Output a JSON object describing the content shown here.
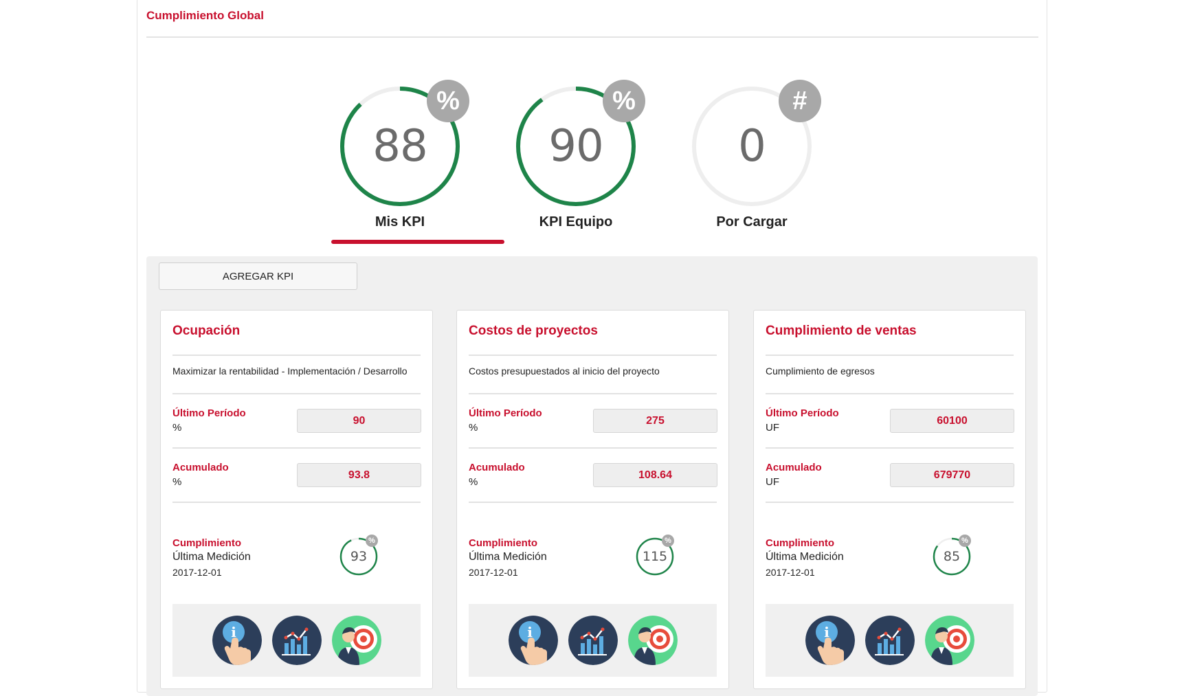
{
  "panel": {
    "title": "Cumplimiento Global"
  },
  "gauges": [
    {
      "value": "88",
      "badge": "%",
      "label": "Mis KPI",
      "fill": 0.88,
      "color": "#1e8449"
    },
    {
      "value": "90",
      "badge": "%",
      "label": "KPI Equipo",
      "fill": 0.9,
      "color": "#1e8449"
    },
    {
      "value": "0",
      "badge": "#",
      "label": "Por Cargar",
      "fill": 0,
      "color": "#1e8449"
    }
  ],
  "active_tab": "Mis KPI",
  "toolbar": {
    "add_kpi": "AGREGAR KPI"
  },
  "labels": {
    "last_period": "Último Período",
    "accumulated": "Acumulado",
    "compliance": "Cumplimiento",
    "last_measurement": "Última Medición"
  },
  "cards": [
    {
      "title": "Ocupación",
      "description": "Maximizar la rentabilidad - Implementación / Desarrollo",
      "last_unit": "%",
      "last_value": "90",
      "acc_unit": "%",
      "acc_value": "93.8",
      "compliance": "93",
      "compliance_fill": 0.93,
      "date": "2017-12-01",
      "badge": "%"
    },
    {
      "title": "Costos de proyectos",
      "description": "Costos presupuestados al inicio del proyecto",
      "last_unit": "%",
      "last_value": "275",
      "acc_unit": "%",
      "acc_value": "108.64",
      "compliance": "115",
      "compliance_fill": 1.0,
      "date": "2017-12-01",
      "badge": "%"
    },
    {
      "title": "Cumplimiento de ventas",
      "description": "Cumplimiento de egresos",
      "last_unit": "UF",
      "last_value": "60100",
      "acc_unit": "UF",
      "acc_value": "679770",
      "compliance": "85",
      "compliance_fill": 0.85,
      "date": "2017-12-01",
      "badge": "%"
    }
  ],
  "icons": [
    "info-hand-icon",
    "bar-chart-icon",
    "target-person-icon"
  ],
  "colors": {
    "accent": "#c8102e",
    "gauge_green": "#1e8449",
    "gauge_track": "#eeeeee"
  }
}
